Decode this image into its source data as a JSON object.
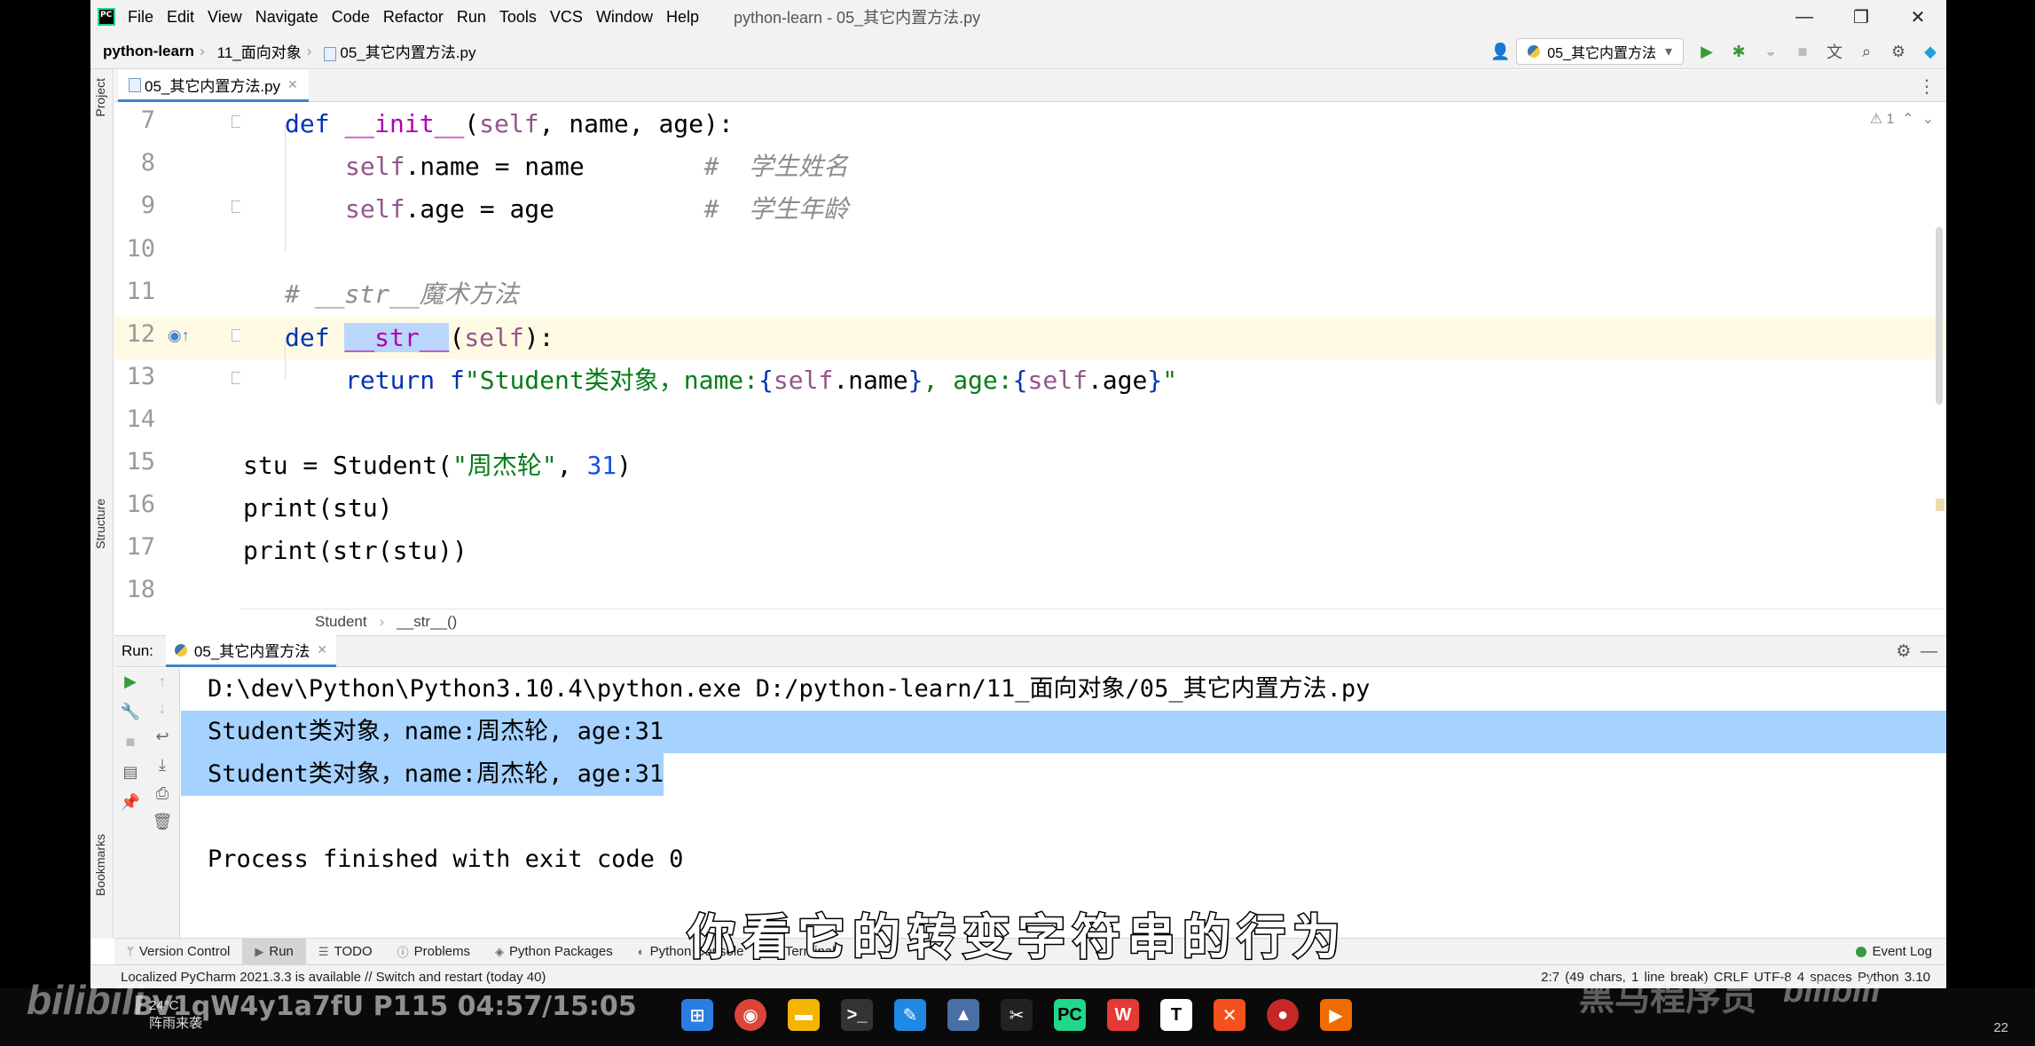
{
  "menubar": {
    "items": [
      "File",
      "Edit",
      "View",
      "Navigate",
      "Code",
      "Refactor",
      "Run",
      "Tools",
      "VCS",
      "Window",
      "Help"
    ],
    "window_title": "python-learn - 05_其它内置方法.py",
    "controls": [
      "—",
      "❐",
      "✕"
    ]
  },
  "navbar": {
    "project": "python-learn",
    "folder": "11_面向对象",
    "file": "05_其它内置方法.py",
    "run_config": "05_其它内置方法"
  },
  "left_strip": {
    "project": "Project",
    "structure": "Structure",
    "bookmarks": "Bookmarks"
  },
  "editor": {
    "tab": "05_其它内置方法.py",
    "inspection": "1",
    "line_numbers": [
      "7",
      "8",
      "9",
      "10",
      "11",
      "12",
      "13",
      "14",
      "15",
      "16",
      "17",
      "18"
    ],
    "code": {
      "l7_kw": "def",
      "l7_name": "__init__",
      "l7_open": "(",
      "l7_self": "self",
      "l7_rest": ", name, age):",
      "l8_self": "self",
      "l8_rest": ".name = name        ",
      "l8_cmt": "#  学生姓名",
      "l9_self": "self",
      "l9_rest": ".age = age          ",
      "l9_cmt": "#  学生年龄",
      "l11_cmt": "# __str__魔术方法",
      "l12_kw": "def",
      "l12_name": "__str__",
      "l12_open": "(",
      "l12_self": "self",
      "l12_rest": "):",
      "l13_kw": "return",
      "l13_f": "f",
      "l13_s1": "\"Student类对象，name:",
      "l13_b1": "{",
      "l13_self1": "self",
      "l13_v1": ".name",
      "l13_b2": "}",
      "l13_s2": ", age:",
      "l13_b3": "{",
      "l13_self2": "self",
      "l13_v2": ".age",
      "l13_b4": "}",
      "l13_s3": "\"",
      "l16_a": "stu = Student(",
      "l16_str": "\"周杰轮\"",
      "l16_b": ", ",
      "l16_num": "31",
      "l16_c": ")",
      "l17": "print(stu)",
      "l18": "print(str(stu))"
    },
    "breadcrumb": [
      "Student",
      "__str__()"
    ]
  },
  "run": {
    "label": "Run:",
    "tab": "05_其它内置方法",
    "console": [
      "D:\\dev\\Python\\Python3.10.4\\python.exe D:/python-learn/11_面向对象/05_其它内置方法.py",
      "Student类对象，name:周杰轮, age:31",
      "Student类对象，name:周杰轮, age:31",
      "",
      "Process finished with exit code 0"
    ]
  },
  "tool_windows": [
    "Version Control",
    "Run",
    "TODO",
    "Problems",
    "Python Packages",
    "Python Console",
    "Terminal"
  ],
  "event_log": "Event Log",
  "status": {
    "message": "Localized PyCharm 2021.3.3 is available // Switch and restart (today 40)",
    "right": "2:7 (49 chars, 1 line break)   CRLF   UTF-8   4 spaces   Python 3.10"
  },
  "subtitle": "你看它的转变字符串的行为",
  "overlay": {
    "video_info": "BV1qW4y1a7fU P115 04:57/15:05",
    "bilibili": "bilibili",
    "weather_temp": "24°C",
    "weather_desc": "阵雨来袭",
    "watermark": "黑马程序员",
    "bilibili_right": "bilibili",
    "tray_num": "22"
  },
  "colors": {
    "keyword": "#0033b3",
    "magic": "#b200b2",
    "self": "#94558d",
    "comment": "#8c8c8c",
    "string": "#067d17",
    "number": "#1750eb",
    "selection": "#a6d2ff",
    "current_line": "#fffae3"
  }
}
